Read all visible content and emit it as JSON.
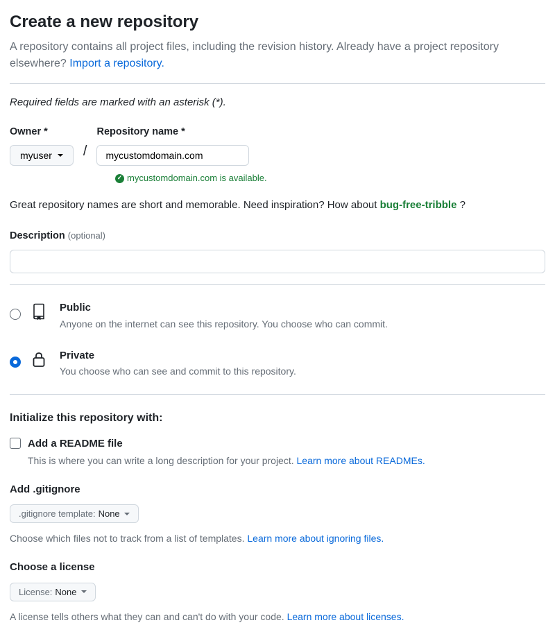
{
  "header": {
    "title": "Create a new repository",
    "subtitle_a": "A repository contains all project files, including the revision history. Already have a project repository elsewhere? ",
    "import_link": "Import a repository."
  },
  "required_note": "Required fields are marked with an asterisk (*).",
  "owner": {
    "label": "Owner *",
    "value": "myuser"
  },
  "repo_name": {
    "label": "Repository name *",
    "value": "mycustomdomain.com",
    "available_text": "mycustomdomain.com is available."
  },
  "inspiration": {
    "prefix": "Great repository names are short and memorable. Need inspiration? How about ",
    "suggestion": "bug-free-tribble",
    "suffix": " ?"
  },
  "description": {
    "label": "Description",
    "optional": "(optional)",
    "value": ""
  },
  "visibility": {
    "public": {
      "title": "Public",
      "desc": "Anyone on the internet can see this repository. You choose who can commit.",
      "checked": false
    },
    "private": {
      "title": "Private",
      "desc": "You choose who can see and commit to this repository.",
      "checked": true
    }
  },
  "initialize": {
    "heading": "Initialize this repository with:",
    "readme": {
      "title": "Add a README file",
      "desc_prefix": "This is where you can write a long description for your project. ",
      "learn_link": "Learn more about READMEs."
    }
  },
  "gitignore": {
    "label": "Add .gitignore",
    "button_prefix": ".gitignore template: ",
    "button_value": "None",
    "helper_prefix": "Choose which files not to track from a list of templates. ",
    "helper_link": "Learn more about ignoring files."
  },
  "license": {
    "label": "Choose a license",
    "button_prefix": "License: ",
    "button_value": "None",
    "helper_prefix": "A license tells others what they can and can't do with your code. ",
    "helper_link": "Learn more about licenses."
  }
}
